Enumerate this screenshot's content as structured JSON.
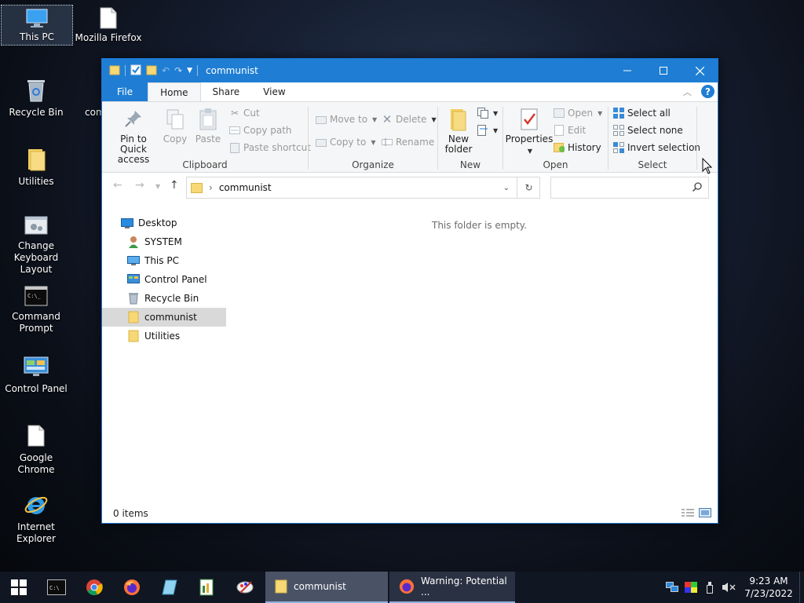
{
  "desktop": {
    "icons": [
      {
        "label": "This PC"
      },
      {
        "label": "Mozilla Firefox"
      },
      {
        "label": "Recycle Bin"
      },
      {
        "label": "com"
      },
      {
        "label": "Utilities"
      },
      {
        "label": "Change Keyboard Layout"
      },
      {
        "label": "Command Prompt"
      },
      {
        "label": "Control Panel"
      },
      {
        "label": "Google Chrome"
      },
      {
        "label": "Internet Explorer"
      }
    ]
  },
  "window": {
    "title": "communist",
    "tabs": [
      "File",
      "Home",
      "Share",
      "View"
    ],
    "ribbon": {
      "clipboard": {
        "label": "Clipboard",
        "pin": "Pin to Quick access",
        "copy": "Copy",
        "paste": "Paste",
        "cut": "Cut",
        "copy_path": "Copy path",
        "paste_shortcut": "Paste shortcut"
      },
      "organize": {
        "label": "Organize",
        "move_to": "Move to",
        "copy_to": "Copy to",
        "delete": "Delete",
        "rename": "Rename"
      },
      "new": {
        "label": "New",
        "new_folder": "New folder"
      },
      "open": {
        "label": "Open",
        "properties": "Properties",
        "open": "Open",
        "edit": "Edit",
        "history": "History"
      },
      "select": {
        "label": "Select",
        "select_all": "Select all",
        "select_none": "Select none",
        "invert": "Invert selection"
      }
    },
    "address": {
      "path": "communist",
      "separator": "›"
    },
    "nav": [
      {
        "label": "Desktop"
      },
      {
        "label": "SYSTEM"
      },
      {
        "label": "This PC"
      },
      {
        "label": "Control Panel"
      },
      {
        "label": "Recycle Bin"
      },
      {
        "label": "communist"
      },
      {
        "label": "Utilities"
      }
    ],
    "empty_message": "This folder is empty.",
    "status": "0 items"
  },
  "taskbar": {
    "apps": [
      {
        "label": "communist"
      },
      {
        "label": "Warning: Potential ..."
      }
    ],
    "time": "9:23 AM",
    "date": "7/23/2022"
  },
  "colors": {
    "accent": "#1f7ed4",
    "taskbar": "#101622",
    "folder": "#f8d775"
  }
}
